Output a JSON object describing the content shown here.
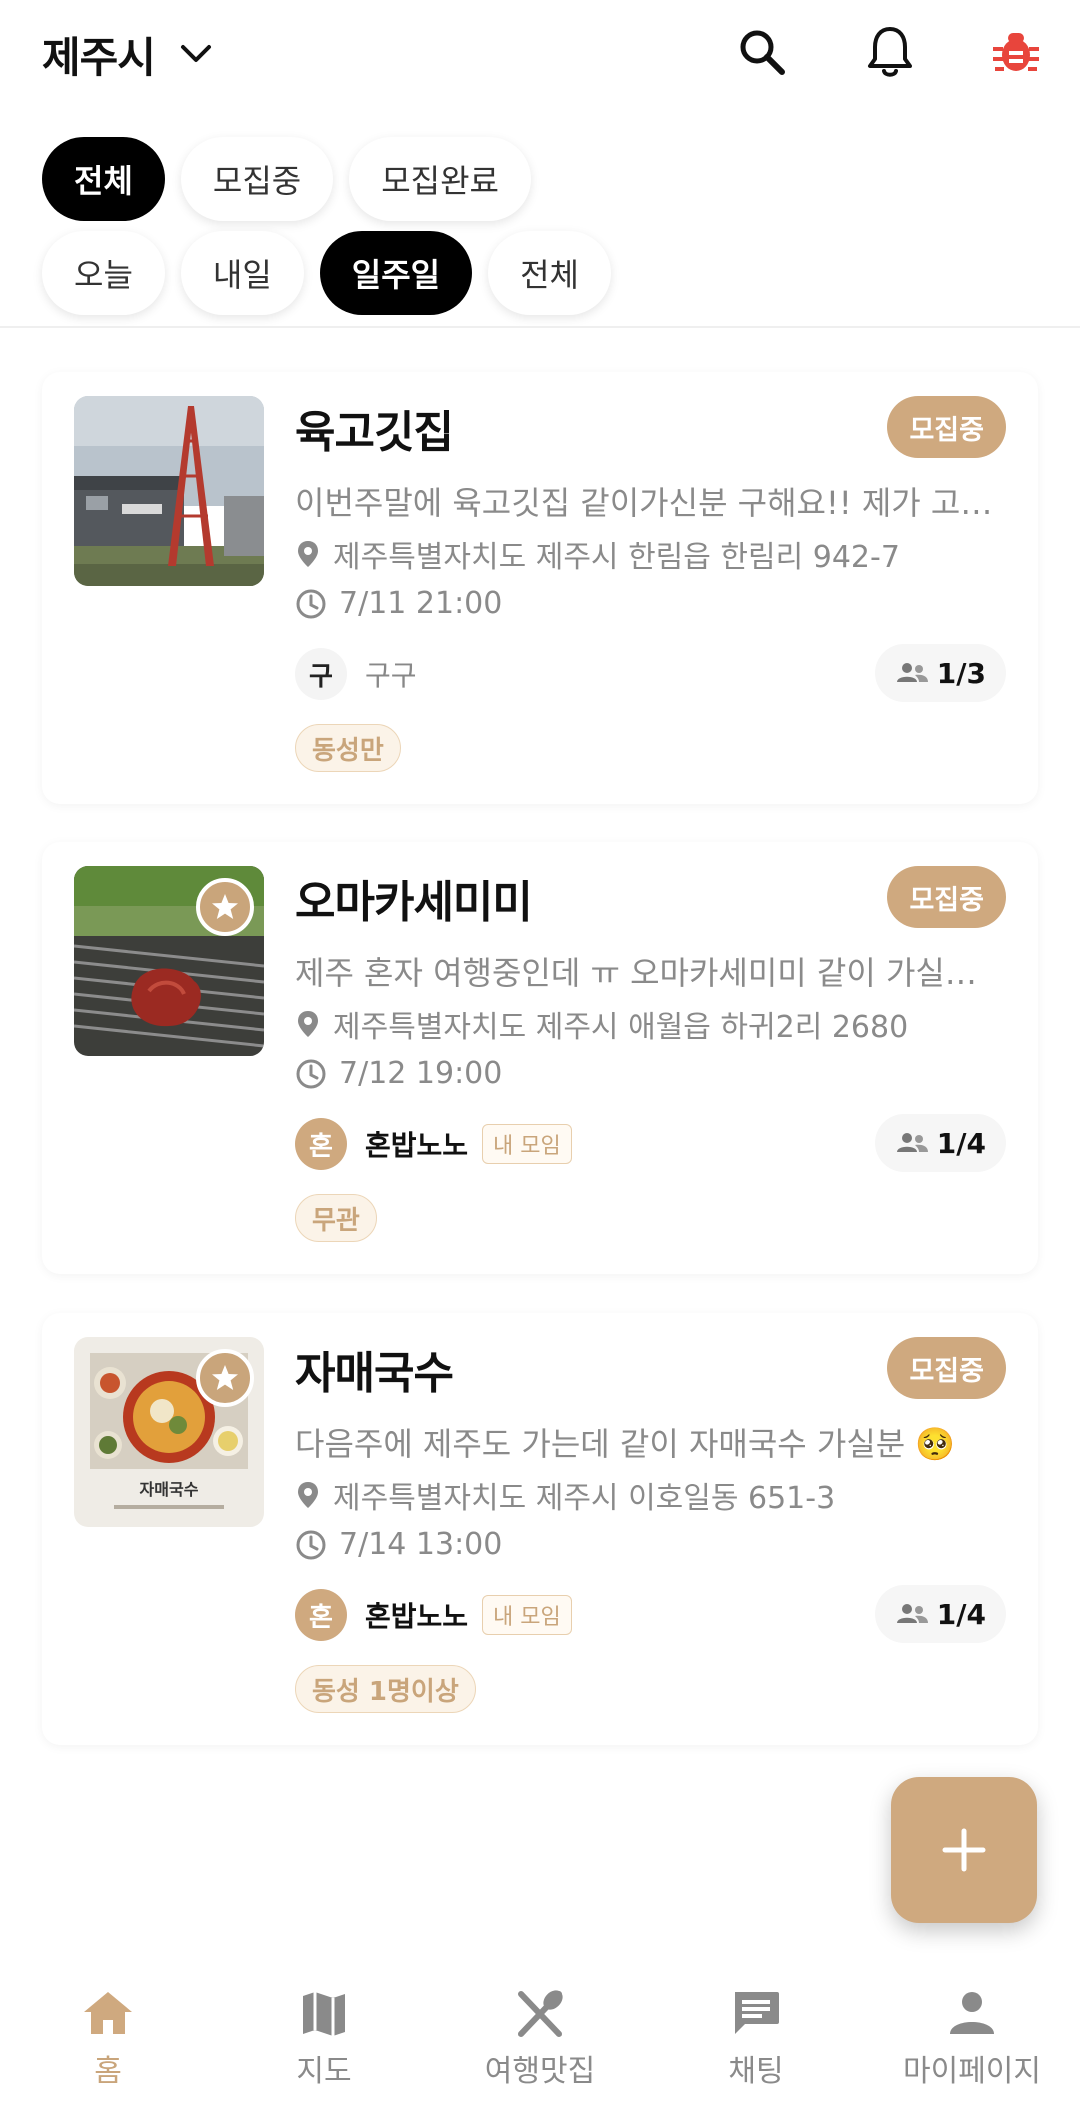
{
  "header": {
    "region": "제주시",
    "icons": [
      "search-icon",
      "bell-icon",
      "bug-icon"
    ],
    "bug_color": "#e8453c"
  },
  "filters": {
    "status_chips": [
      "전체",
      "모집중",
      "모집완료"
    ],
    "status_selected": "전체",
    "date_chips": [
      "오늘",
      "내일",
      "일주일",
      "전체"
    ],
    "date_selected": "일주일"
  },
  "posts": [
    {
      "title": "육고깃집",
      "status": "모집중",
      "description": "이번주말에 육고깃집 같이가신분 구해요!! 제가 고기 잘 구워요",
      "address": "제주특별자치도 제주시 한림읍 한림리 942-7",
      "datetime": "7/11 21:00",
      "host_initial": "구",
      "host_name": "구구",
      "count": "1/3",
      "tag": "동성만"
    },
    {
      "title": "오마카세미미",
      "status": "모집중",
      "description": "제주 혼자 여행중인데 ㅠ 오마카세미미 같이 가실분 구해요",
      "address": "제주특별자치도 제주시 애월읍 하귀2리 2680",
      "datetime": "7/12 19:00",
      "host_initial": "혼",
      "host_name": "혼밥노노",
      "mine_badge": "내 모임",
      "count": "1/4",
      "tag": "무관"
    },
    {
      "title": "자매국수",
      "status": "모집중",
      "description": "다음주에 제주도 가는데 같이 자매국수 가실분 🥺",
      "address": "제주특별자치도 제주시 이호일동 651-3",
      "datetime": "7/14 13:00",
      "host_initial": "혼",
      "host_name": "혼밥노노",
      "mine_badge": "내 모임",
      "count": "1/4",
      "tag": "동성 1명이상",
      "thumb_caption": "자매국수"
    }
  ],
  "nav": {
    "items": [
      "홈",
      "지도",
      "여행맛집",
      "채팅",
      "마이페이지"
    ],
    "active": "홈"
  },
  "colors": {
    "accent": "#cfa97f",
    "accent_text": "#c9a57b",
    "muted": "#8a8a8a"
  }
}
